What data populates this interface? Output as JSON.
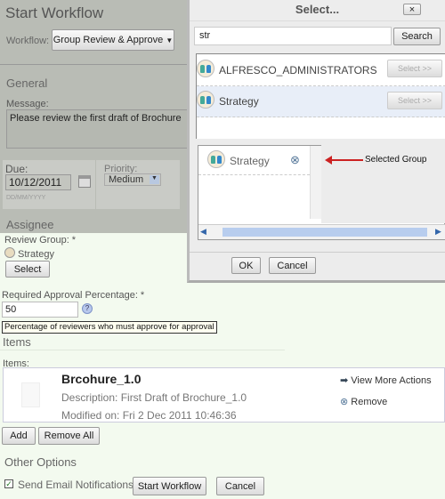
{
  "form": {
    "title": "Start Workflow",
    "workflow_label": "Workflow:",
    "workflow_value": "Group Review & Approve",
    "general_heading": "General",
    "message_label": "Message:",
    "message_value": "Please review  the first draft of Brochure",
    "due_label": "Due:",
    "due_value": "10/12/2011",
    "due_hint": "DD/MM/YYYY",
    "priority_label": "Priority:",
    "priority_value": "Medium",
    "assignee_heading": "Assignee",
    "review_group_label": "Review Group: *",
    "review_group_value": "Strategy",
    "select_button": "Select",
    "approval_label": "Required Approval Percentage: *",
    "approval_value": "50",
    "approval_tooltip": "Percentage of reviewers who must approve for approval",
    "items_heading": "Items",
    "items_label": "Items:",
    "item": {
      "name": "Brcohure_1.0",
      "description": "Description: First Draft of Brochure_1.0",
      "modified": "Modified on: Fri 2 Dec 2011 10:46:36",
      "view_more": "View More Actions",
      "remove": "Remove"
    },
    "add_button": "Add",
    "remove_all_button": "Remove All",
    "other_heading": "Other Options",
    "email_label": "Send Email Notifications",
    "email_checked": true,
    "start_button": "Start Workflow",
    "cancel_button": "Cancel"
  },
  "dialog": {
    "title": "Select...",
    "close": "×",
    "search_value": "str",
    "search_button": "Search",
    "results": [
      {
        "name": "ALFRESCO_ADMINISTRATORS",
        "action": "Select >>"
      },
      {
        "name": "Strategy",
        "action": "Select >>"
      }
    ],
    "selected": [
      {
        "name": "Strategy"
      }
    ],
    "annotation": "Selected Group",
    "ok_button": "OK",
    "cancel_button": "Cancel"
  },
  "colors": {
    "annotation_arrow": "#cc2222",
    "selected_row": "#e8eef8",
    "scrollbar": "#b8cdee"
  }
}
